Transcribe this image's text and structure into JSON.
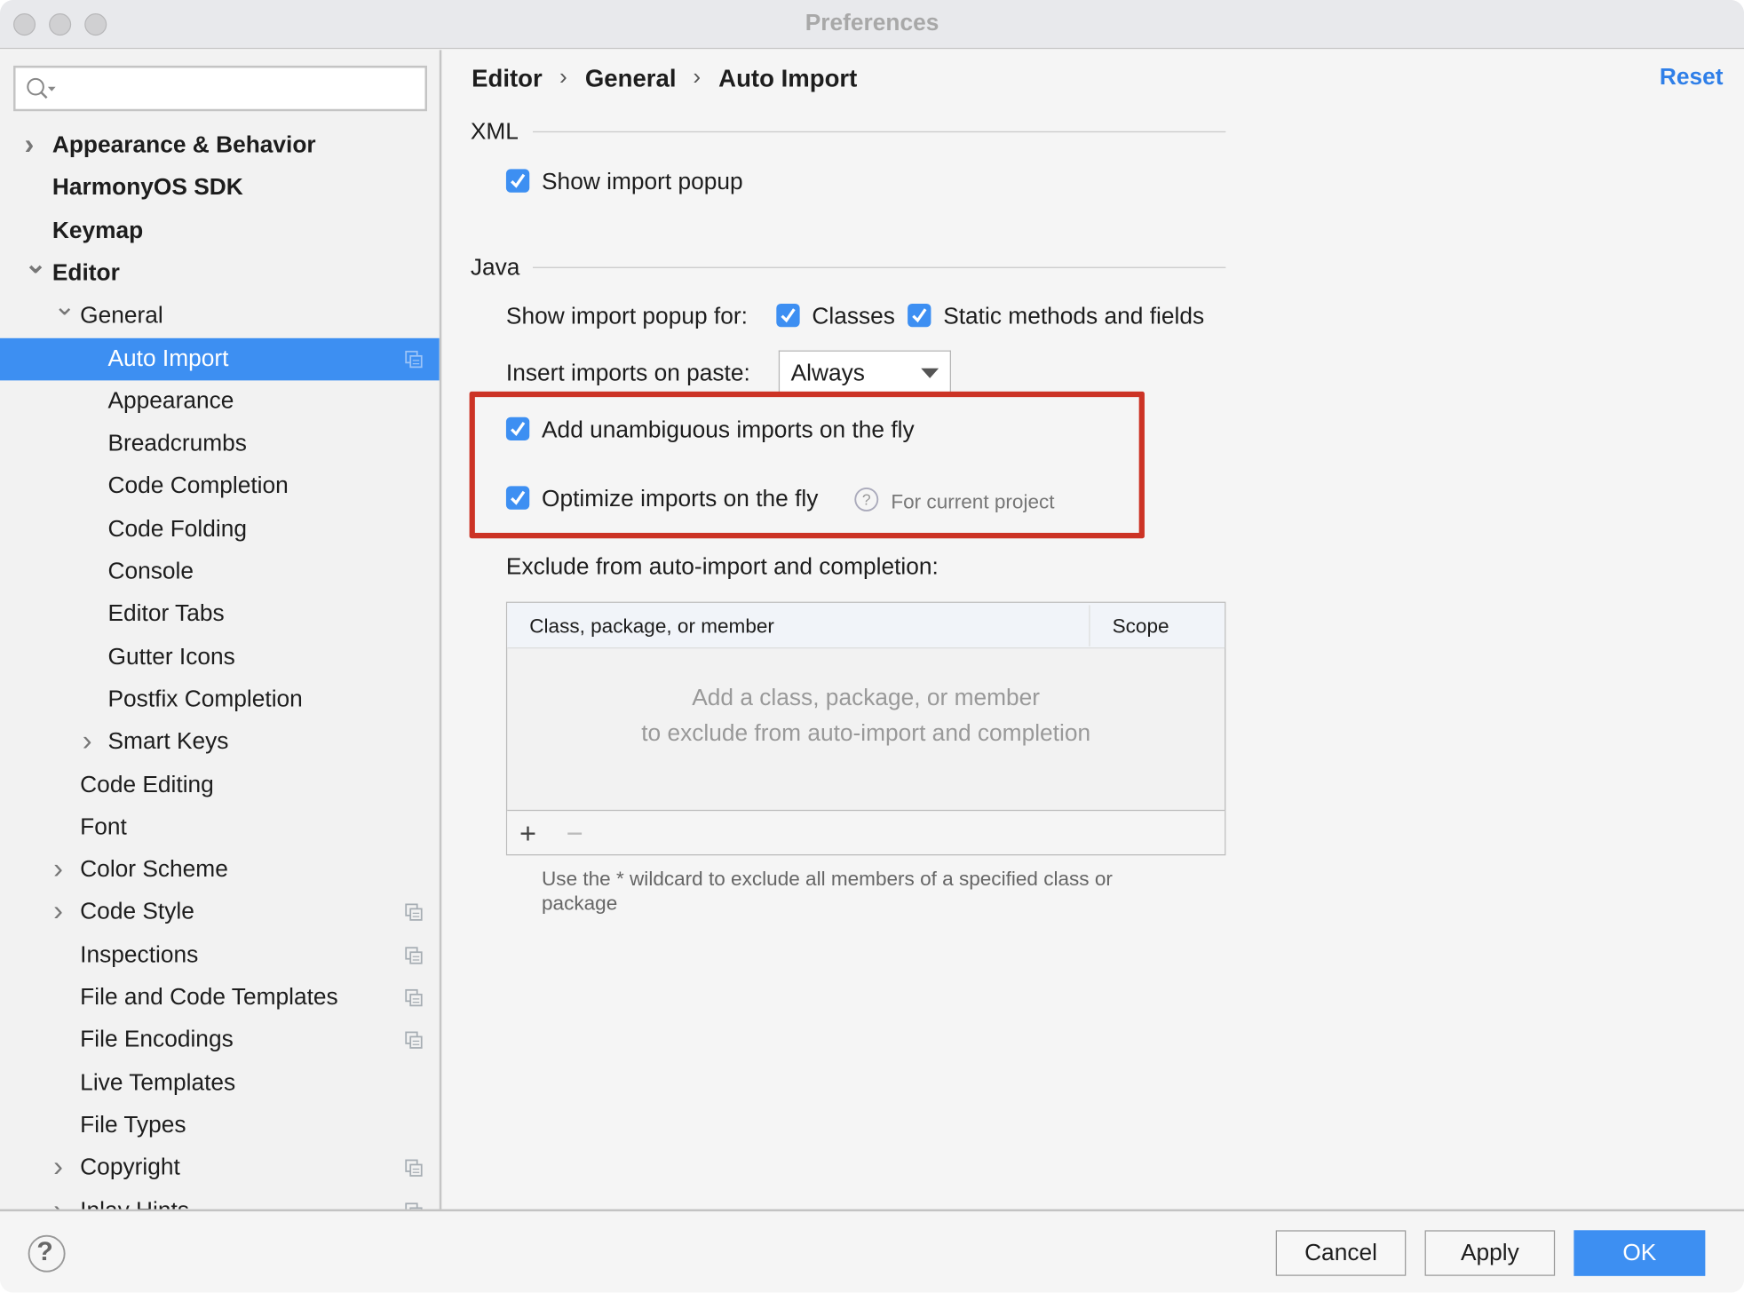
{
  "window": {
    "title": "Preferences"
  },
  "search": {
    "placeholder": ""
  },
  "sidebar": {
    "items": [
      {
        "label": "Appearance & Behavior",
        "level": 0,
        "bold": true,
        "chevron": "right"
      },
      {
        "label": "HarmonyOS SDK",
        "level": 0,
        "bold": true
      },
      {
        "label": "Keymap",
        "level": 0,
        "bold": true
      },
      {
        "label": "Editor",
        "level": 0,
        "bold": true,
        "chevron": "down"
      },
      {
        "label": "General",
        "level": 1,
        "chevron": "down"
      },
      {
        "label": "Auto Import",
        "level": 2,
        "selected": true,
        "project_icon": true
      },
      {
        "label": "Appearance",
        "level": 2
      },
      {
        "label": "Breadcrumbs",
        "level": 2
      },
      {
        "label": "Code Completion",
        "level": 2
      },
      {
        "label": "Code Folding",
        "level": 2
      },
      {
        "label": "Console",
        "level": 2
      },
      {
        "label": "Editor Tabs",
        "level": 2
      },
      {
        "label": "Gutter Icons",
        "level": 2
      },
      {
        "label": "Postfix Completion",
        "level": 2
      },
      {
        "label": "Smart Keys",
        "level": 2,
        "chevron": "right"
      },
      {
        "label": "Code Editing",
        "level": 1
      },
      {
        "label": "Font",
        "level": 1
      },
      {
        "label": "Color Scheme",
        "level": 1,
        "chevron": "right"
      },
      {
        "label": "Code Style",
        "level": 1,
        "chevron": "right",
        "project_icon": true
      },
      {
        "label": "Inspections",
        "level": 1,
        "project_icon": true
      },
      {
        "label": "File and Code Templates",
        "level": 1,
        "project_icon": true
      },
      {
        "label": "File Encodings",
        "level": 1,
        "project_icon": true
      },
      {
        "label": "Live Templates",
        "level": 1
      },
      {
        "label": "File Types",
        "level": 1
      },
      {
        "label": "Copyright",
        "level": 1,
        "chevron": "right",
        "project_icon": true
      },
      {
        "label": "Inlay Hints",
        "level": 1,
        "chevron": "right",
        "project_icon": true
      }
    ]
  },
  "breadcrumb": {
    "items": [
      "Editor",
      "General",
      "Auto Import"
    ],
    "separator": "›"
  },
  "reset_label": "Reset",
  "xml": {
    "section": "XML",
    "show_import_popup": {
      "label": "Show import popup",
      "checked": true
    }
  },
  "java": {
    "section": "Java",
    "show_popup_for_label": "Show import popup for:",
    "classes": {
      "label": "Classes",
      "checked": true
    },
    "static": {
      "label": "Static methods and fields",
      "checked": true
    },
    "insert_on_paste_label": "Insert imports on paste:",
    "insert_on_paste_value": "Always",
    "add_unambiguous": {
      "label": "Add unambiguous imports on the fly",
      "checked": true
    },
    "optimize": {
      "label": "Optimize imports on the fly",
      "checked": true,
      "hint": "For current project"
    },
    "exclude_label": "Exclude from auto-import and completion:",
    "table": {
      "columns": [
        "Class, package, or member",
        "Scope"
      ],
      "empty_line1": "Add a class, package, or member",
      "empty_line2": "to exclude from auto-import and completion",
      "add": "+",
      "remove": "−"
    },
    "wildcard_note": "Use the * wildcard to exclude all members of a specified class or package"
  },
  "footer": {
    "cancel": "Cancel",
    "apply": "Apply",
    "ok": "OK",
    "help": "?"
  },
  "colors": {
    "accent": "#3d8ff2",
    "highlight_box": "#cc3325"
  }
}
